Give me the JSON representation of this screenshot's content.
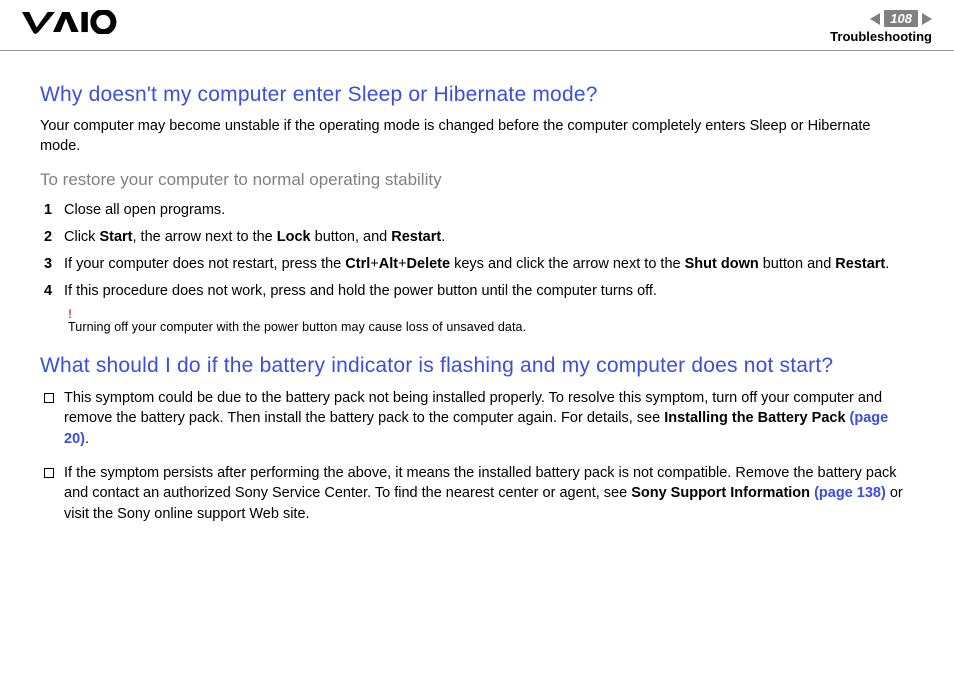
{
  "header": {
    "page_number": "108",
    "section": "Troubleshooting"
  },
  "q1": {
    "title": "Why doesn't my computer enter Sleep or Hibernate mode?",
    "intro": "Your computer may become unstable if the operating mode is changed before the computer completely enters Sleep or Hibernate mode.",
    "subhead": "To restore your computer to normal operating stability",
    "steps": [
      {
        "n": "1",
        "text": "Close all open programs."
      },
      {
        "n": "2",
        "pre": "Click ",
        "b1": "Start",
        "mid1": ", the arrow next to the ",
        "b2": "Lock",
        "mid2": " button, and ",
        "b3": "Restart",
        "post": "."
      },
      {
        "n": "3",
        "pre": "If your computer does not restart, press the ",
        "b1": "Ctrl",
        "plus1": "+",
        "b2": "Alt",
        "plus2": "+",
        "b3": "Delete",
        "mid": " keys and click the arrow next to the ",
        "b4": "Shut down",
        "mid2": " button and ",
        "b5": "Restart",
        "post": "."
      },
      {
        "n": "4",
        "text": "If this procedure does not work, press and hold the power button until the computer turns off."
      }
    ],
    "warn_mark": "!",
    "warn_text": "Turning off your computer with the power button may cause loss of unsaved data."
  },
  "q2": {
    "title": "What should I do if the battery indicator is flashing and my computer does not start?",
    "bullets": [
      {
        "pre": "This symptom could be due to the battery pack not being installed properly. To resolve this symptom, turn off your computer and remove the battery pack. Then install the battery pack to the computer again. For details, see ",
        "b1": "Installing the Battery Pack ",
        "lk": "(page 20)",
        "post": "."
      },
      {
        "pre": "If the symptom persists after performing the above, it means the installed battery pack is not compatible. Remove the battery pack and contact an authorized Sony Service Center. To find the nearest center or agent, see ",
        "b1": "Sony Support Information ",
        "lk": "(page 138)",
        "post": " or visit the Sony online support Web site."
      }
    ]
  }
}
